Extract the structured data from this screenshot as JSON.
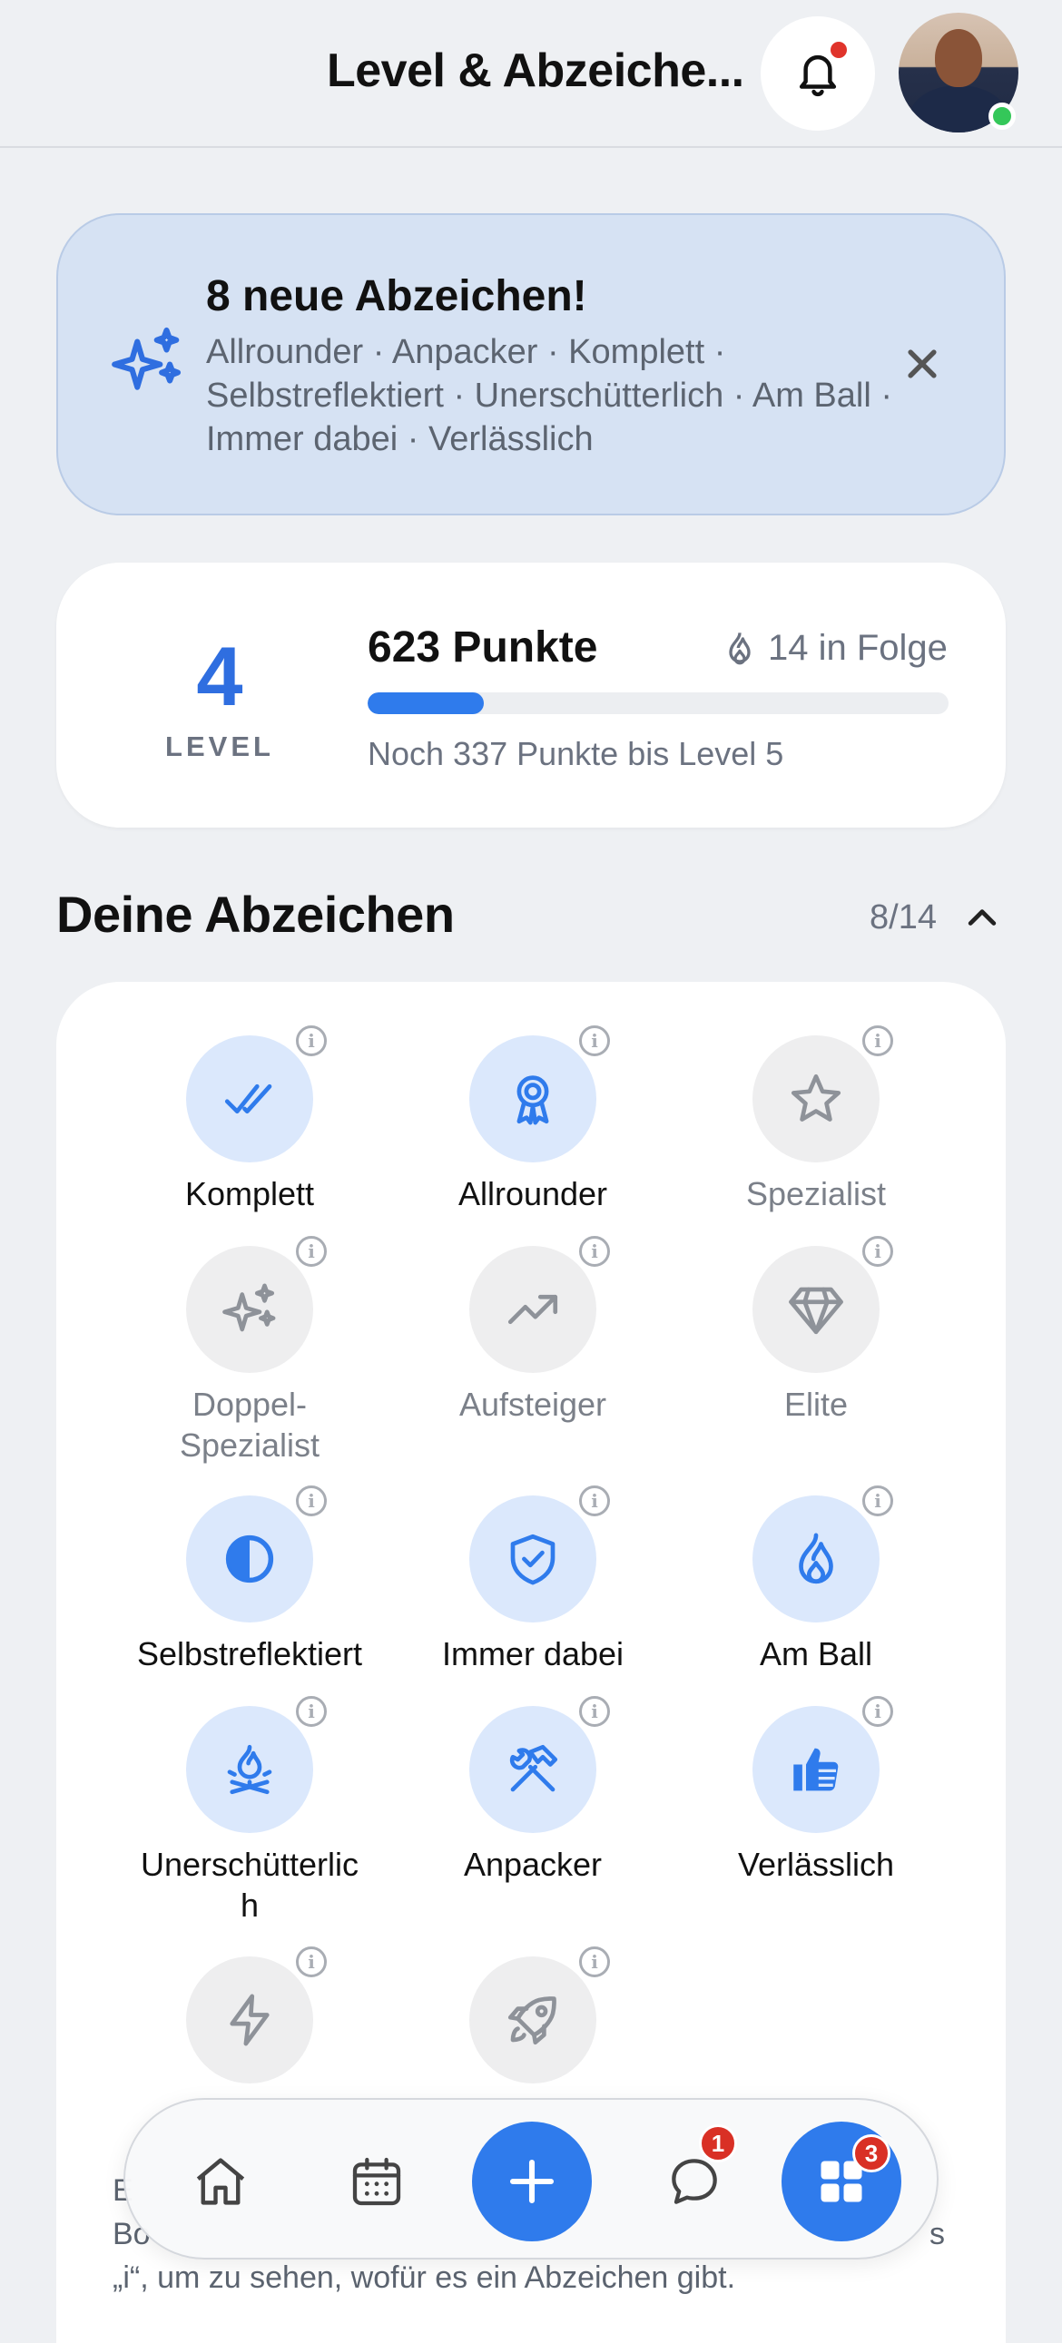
{
  "header": {
    "title": "Level & Abzeiche...",
    "notifications_icon": "bell-icon",
    "notification_dot_color": "#e0342b",
    "avatar_status": "online"
  },
  "banner": {
    "title": "8 neue Abzeichen!",
    "text": "Allrounder · Anpacker · Komplett · Selbstreflektiert · Unerschütterlich · Am Ball · Immer dabei · Verlässlich",
    "icon": "sparkles-icon",
    "close_icon": "close-icon"
  },
  "level": {
    "number": "4",
    "label": "LEVEL",
    "points": "623 Punkte",
    "streak": "14 in Folge",
    "progress": 0.2,
    "subtext": "Noch 337 Punkte bis Level 5"
  },
  "badges_section": {
    "title": "Deine Abzeichen",
    "count": "8/14",
    "toggle_icon": "chevron-up-icon",
    "items": [
      {
        "label": "Komplett",
        "icon": "double-check-icon",
        "earned": true
      },
      {
        "label": "Allrounder",
        "icon": "award-ribbon-icon",
        "earned": true
      },
      {
        "label": "Spezialist",
        "icon": "star-icon",
        "earned": false
      },
      {
        "label": "Doppel-Spezialist",
        "icon": "sparkles-icon",
        "earned": false
      },
      {
        "label": "Aufsteiger",
        "icon": "trending-up-icon",
        "earned": false
      },
      {
        "label": "Elite",
        "icon": "diamond-icon",
        "earned": false
      },
      {
        "label": "Selbstreflektiert",
        "icon": "half-circle-icon",
        "earned": true
      },
      {
        "label": "Immer dabei",
        "icon": "shield-check-icon",
        "earned": true
      },
      {
        "label": "Am Ball",
        "icon": "flame-icon",
        "earned": true
      },
      {
        "label": "Unerschütterlich",
        "icon": "campfire-icon",
        "earned": true
      },
      {
        "label": "Anpacker",
        "icon": "hammer-wrench-icon",
        "earned": true
      },
      {
        "label": "Verlässlich",
        "icon": "thumbs-up-icon",
        "earned": true
      },
      {
        "label": "",
        "icon": "lightning-icon",
        "earned": false
      },
      {
        "label": "",
        "icon": "rocket-icon",
        "earned": false
      }
    ],
    "info_icon": "i",
    "footer_line1": "E",
    "footer_line2": "Bo",
    "footer_line3": "„i“, um zu sehen, wofür es ein Abzeichen gibt.",
    "footer_tail": "s"
  },
  "bottom_nav": {
    "items": [
      "home-icon",
      "calendar-icon",
      "plus-icon",
      "chat-icon",
      "apps-grid-icon"
    ],
    "chat_badge": "1",
    "apps_badge": "3"
  },
  "colors": {
    "accent": "#2f7bec",
    "earned_bg": "#dbe8fc",
    "locked_bg": "#eeeeef",
    "banner_bg": "#d6e2f3"
  }
}
